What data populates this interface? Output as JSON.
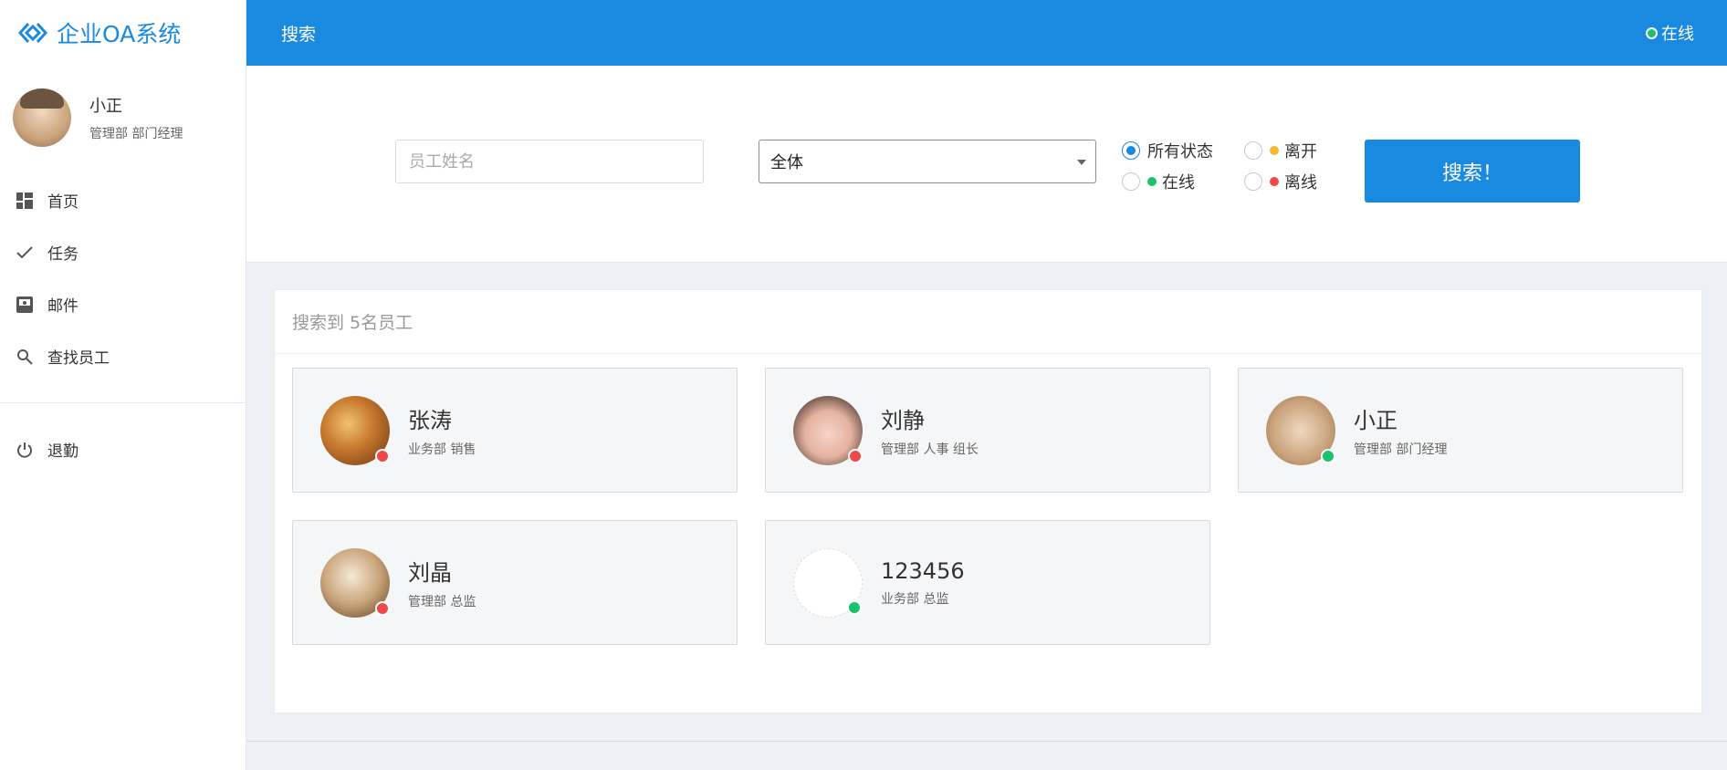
{
  "app": {
    "title": "企业OA系统"
  },
  "user": {
    "name": "小正",
    "role": "管理部 部门经理"
  },
  "nav": {
    "items": [
      {
        "label": "首页",
        "icon": "dashboard-icon"
      },
      {
        "label": "任务",
        "icon": "check-icon"
      },
      {
        "label": "邮件",
        "icon": "inbox-icon"
      },
      {
        "label": "查找员工",
        "icon": "search-icon"
      }
    ],
    "logout": {
      "label": "退勤",
      "icon": "power-icon"
    }
  },
  "header": {
    "title": "搜索",
    "status": "在线"
  },
  "search": {
    "name_placeholder": "员工姓名",
    "name_value": "",
    "department_selected": "全体",
    "status_options": [
      {
        "label": "所有状态",
        "checked": true,
        "dot_color": ""
      },
      {
        "label": "离开",
        "checked": false,
        "dot_color": "#f5b731"
      },
      {
        "label": "在线",
        "checked": false,
        "dot_color": "#19c26b"
      },
      {
        "label": "离线",
        "checked": false,
        "dot_color": "#f04848"
      }
    ],
    "button_label": "搜索！"
  },
  "results": {
    "title": "搜索到 5名员工",
    "employees": [
      {
        "name": "张涛",
        "dept": "业务部 销售",
        "status": "离线",
        "status_color": "#f04848"
      },
      {
        "name": "刘静",
        "dept": "管理部 人事 组长",
        "status": "离线",
        "status_color": "#f04848"
      },
      {
        "name": "小正",
        "dept": "管理部 部门经理",
        "status": "在线",
        "status_color": "#19c26b"
      },
      {
        "name": "刘晶",
        "dept": "管理部 总监",
        "status": "离线",
        "status_color": "#f04848"
      },
      {
        "name": "123456",
        "dept": "业务部 总监",
        "status": "在线",
        "status_color": "#19c26b"
      }
    ]
  },
  "colors": {
    "primary": "#1a89e0",
    "online": "#19c26b",
    "offline": "#f04848",
    "away": "#f5b731"
  }
}
